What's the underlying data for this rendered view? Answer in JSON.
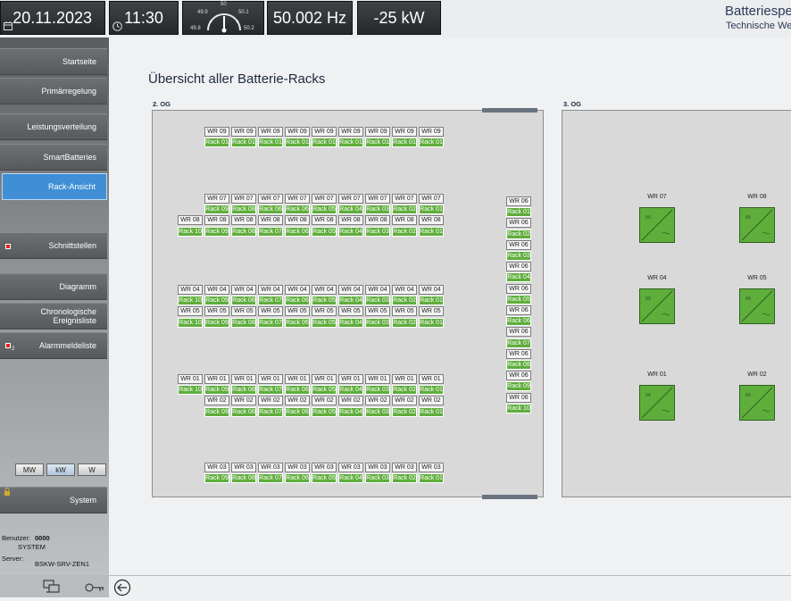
{
  "header": {
    "date": "20.11.2023",
    "time": "11:30",
    "gauge": {
      "center": "50",
      "left_top": "49.9",
      "right_top": "50.1",
      "left_bottom": "49.8",
      "right_bottom": "50.2"
    },
    "frequency": "50.002 Hz",
    "power": "-25 kW",
    "app_title": "Batteriespe",
    "app_subtitle": "Technische Wer"
  },
  "sidebar": {
    "items": [
      {
        "label": "Startseite"
      },
      {
        "label": "Primärregelung"
      },
      {
        "label": "Leistungsverteilung"
      },
      {
        "label": "SmartBatteries"
      },
      {
        "label": "Rack-Ansicht",
        "active": true
      },
      {
        "label": "Schnittstellen"
      },
      {
        "label": "Diagramm"
      },
      {
        "label": "Chronologische Ereignisliste"
      },
      {
        "label": "Alarmmeldeliste",
        "badge": "2"
      }
    ],
    "units": [
      "MW",
      "kW",
      "W"
    ],
    "selected_unit": "kW",
    "system_label": "System",
    "user_label": "Benutzer:",
    "user_id": "0000",
    "user_name": "SYSTEM",
    "server_label": "Server:",
    "server_name": "BSKW-SRV-ZEN1"
  },
  "main": {
    "title": "Übersicht aller Batterie-Racks",
    "floor2_label": "2. OG",
    "floor3_label": "3. OG"
  },
  "floor2": {
    "groups": [
      {
        "rows": [
          {
            "kind": "wr",
            "cells": [
              "WR 09",
              "WR 09",
              "WR 09",
              "WR 09",
              "WR 09",
              "WR 09",
              "WR 09",
              "WR 09",
              "WR 09"
            ]
          },
          {
            "kind": "rack",
            "cells": [
              "Rack 01",
              "Rack 01",
              "Rack 01",
              "Rack 01",
              "Rack 01",
              "Rack 01",
              "Rack 01",
              "Rack 01",
              "Rack 01"
            ]
          }
        ]
      },
      {
        "rows": [
          {
            "kind": "wr",
            "cells": [
              "WR 07",
              "WR 07",
              "WR 07",
              "WR 07",
              "WR 07",
              "WR 07",
              "WR 07",
              "WR 07",
              "WR 07"
            ]
          },
          {
            "kind": "rack",
            "cells": [
              "Rack 09",
              "Rack 08",
              "Rack 06",
              "Rack 06",
              "Rack 05",
              "Rack 04",
              "Rack 03",
              "Rack 02",
              "Rack 01"
            ]
          },
          {
            "kind": "wr",
            "cells": [
              "WR 08",
              "WR 08",
              "WR 08",
              "WR 08",
              "WR 08",
              "WR 08",
              "WR 08",
              "WR 08",
              "WR 08",
              "WR 08"
            ]
          },
          {
            "kind": "rack",
            "cells": [
              "Rack 10",
              "Rack 09",
              "Rack 08",
              "Rack 07",
              "Rack 06",
              "Rack 05",
              "Rack 04",
              "Rack 03",
              "Rack 02",
              "Rack 01"
            ]
          }
        ]
      },
      {
        "rows": [
          {
            "kind": "wr",
            "cells": [
              "WR 04",
              "WR 04",
              "WR 04",
              "WR 04",
              "WR 04",
              "WR 04",
              "WR 04",
              "WR 04",
              "WR 04",
              "WR 04"
            ]
          },
          {
            "kind": "rack",
            "cells": [
              "Rack 10",
              "Rack 09",
              "Rack 08",
              "Rack 07",
              "Rack 06",
              "Rack 05",
              "Rack 04",
              "Rack 03",
              "Rack 02",
              "Rack 01"
            ]
          },
          {
            "kind": "wr",
            "cells": [
              "WR 05",
              "WR 05",
              "WR 05",
              "WR 05",
              "WR 05",
              "WR 05",
              "WR 05",
              "WR 05",
              "WR 05",
              "WR 05"
            ]
          },
          {
            "kind": "rack",
            "cells": [
              "Rack 10",
              "Rack 09",
              "Rack 08",
              "Rack 07",
              "Rack 06",
              "Rack 05",
              "Rack 04",
              "Rack 03",
              "Rack 02",
              "Rack 01"
            ]
          }
        ]
      },
      {
        "rows": [
          {
            "kind": "wr",
            "cells": [
              "WR 01",
              "WR 01",
              "WR 01",
              "WR 01",
              "WR 01",
              "WR 01",
              "WR 01",
              "WR 01",
              "WR 01",
              "WR 01"
            ]
          },
          {
            "kind": "rack",
            "cells": [
              "Rack 10",
              "Rack 09",
              "Rack 08",
              "Rack 07",
              "Rack 06",
              "Rack 05",
              "Rack 04",
              "Rack 03",
              "Rack 02",
              "Rack 01"
            ]
          },
          {
            "kind": "wr",
            "cells": [
              "WR 02",
              "WR 02",
              "WR 02",
              "WR 02",
              "WR 02",
              "WR 02",
              "WR 02",
              "WR 02",
              "WR 02"
            ]
          },
          {
            "kind": "rack",
            "cells": [
              "Rack 09",
              "Rack 08",
              "Rack 07",
              "Rack 06",
              "Rack 05",
              "Rack 04",
              "Rack 03",
              "Rack 02",
              "Rack 01"
            ]
          }
        ]
      },
      {
        "rows": [
          {
            "kind": "wr",
            "cells": [
              "WR 03",
              "WR 03",
              "WR 03",
              "WR 03",
              "WR 03",
              "WR 03",
              "WR 03",
              "WR 03",
              "WR 03"
            ]
          },
          {
            "kind": "rack",
            "cells": [
              "Rack 09",
              "Rack 08",
              "Rack 07",
              "Rack 06",
              "Rack 05",
              "Rack 04",
              "Rack 03",
              "Rack 02",
              "Rack 01"
            ]
          }
        ]
      }
    ],
    "column": [
      {
        "kind": "wr",
        "text": "WR 06"
      },
      {
        "kind": "rack",
        "text": "Rack 01"
      },
      {
        "kind": "wr",
        "text": "WR 06"
      },
      {
        "kind": "rack",
        "text": "Rack 02"
      },
      {
        "kind": "wr",
        "text": "WR 06"
      },
      {
        "kind": "rack",
        "text": "Rack 03"
      },
      {
        "kind": "wr",
        "text": "WR 06"
      },
      {
        "kind": "rack",
        "text": "Rack 04"
      },
      {
        "kind": "wr",
        "text": "WR 06"
      },
      {
        "kind": "rack",
        "text": "Rack 05"
      },
      {
        "kind": "wr",
        "text": "WR 06"
      },
      {
        "kind": "rack",
        "text": "Rack 06"
      },
      {
        "kind": "wr",
        "text": "WR 06"
      },
      {
        "kind": "rack",
        "text": "Rack 07"
      },
      {
        "kind": "wr",
        "text": "WR 06"
      },
      {
        "kind": "rack",
        "text": "Rack 08"
      },
      {
        "kind": "wr",
        "text": "WR 06"
      },
      {
        "kind": "rack",
        "text": "Rack 09"
      },
      {
        "kind": "wr",
        "text": "WR 06"
      },
      {
        "kind": "rack",
        "text": "Rack 10"
      }
    ]
  },
  "floor3": {
    "inverters": [
      {
        "label": "WR 07"
      },
      {
        "label": "WR 08"
      },
      {
        "label": "WR 04"
      },
      {
        "label": "WR 05"
      },
      {
        "label": "WR 01"
      },
      {
        "label": "WR 02"
      }
    ]
  }
}
